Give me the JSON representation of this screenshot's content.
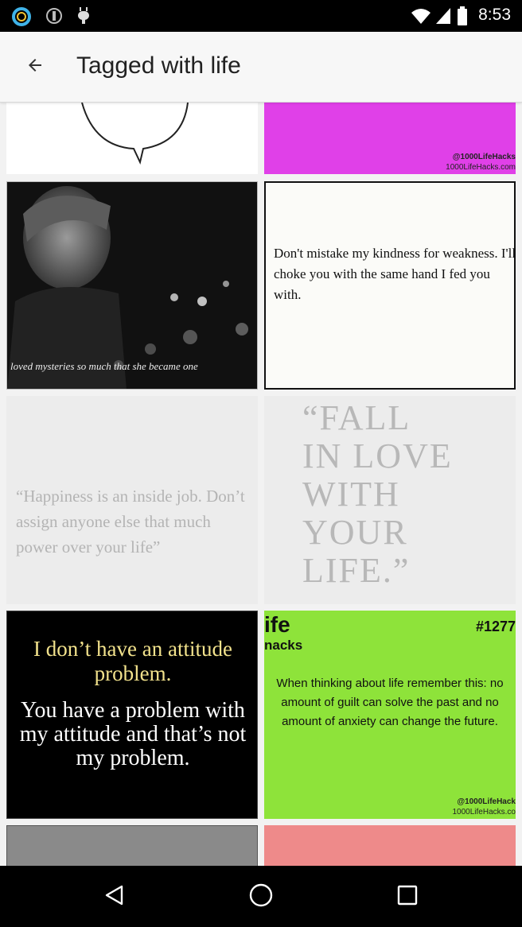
{
  "status_bar": {
    "time": "8:53",
    "icons": [
      "sync-circle-icon",
      "alert-icon",
      "android-icon"
    ],
    "right_icons": [
      "wifi-icon",
      "signal-icon",
      "battery-icon"
    ]
  },
  "app_bar": {
    "title": "Tagged with life",
    "back_icon": "arrow-back-icon"
  },
  "tiles": {
    "top_right": {
      "handle": "@1000LifeHacks",
      "site": "1000LifeHacks.com",
      "color": "#e040e8"
    },
    "row1_left": {
      "caption": "loved mysteries so much that she became one"
    },
    "row1_right": {
      "quote": "Don't mistake my kindness for weakness. I'll choke you with the same hand I fed you with."
    },
    "row2_left": {
      "quote": "“Happiness is an inside job. Don’t assign anyone else that much power over your life”"
    },
    "row2_right": {
      "lines": [
        "“FALL",
        "IN LOVE",
        "WITH",
        "YOUR",
        "LIFE.”"
      ]
    },
    "row3_left": {
      "line1": "I don’t have an attitude problem.",
      "line2": "You have a problem with my attitude and that’s not my problem."
    },
    "row3_right": {
      "brand_top": "ife",
      "brand_bottom": "nacks",
      "number": "#1277",
      "text": "When thinking about life remember this: no amount of guilt can solve the past and no amount of anxiety can change the future.",
      "handle": "@1000LifeHack",
      "site": "1000LifeHacks.co",
      "color": "#8ee33a"
    },
    "row4_left": {
      "color": "#8a8a8a"
    },
    "row4_right": {
      "color": "#ee8a8a"
    }
  },
  "nav_bar": {
    "back": "nav-back-icon",
    "home": "nav-home-icon",
    "recents": "nav-recents-icon"
  }
}
